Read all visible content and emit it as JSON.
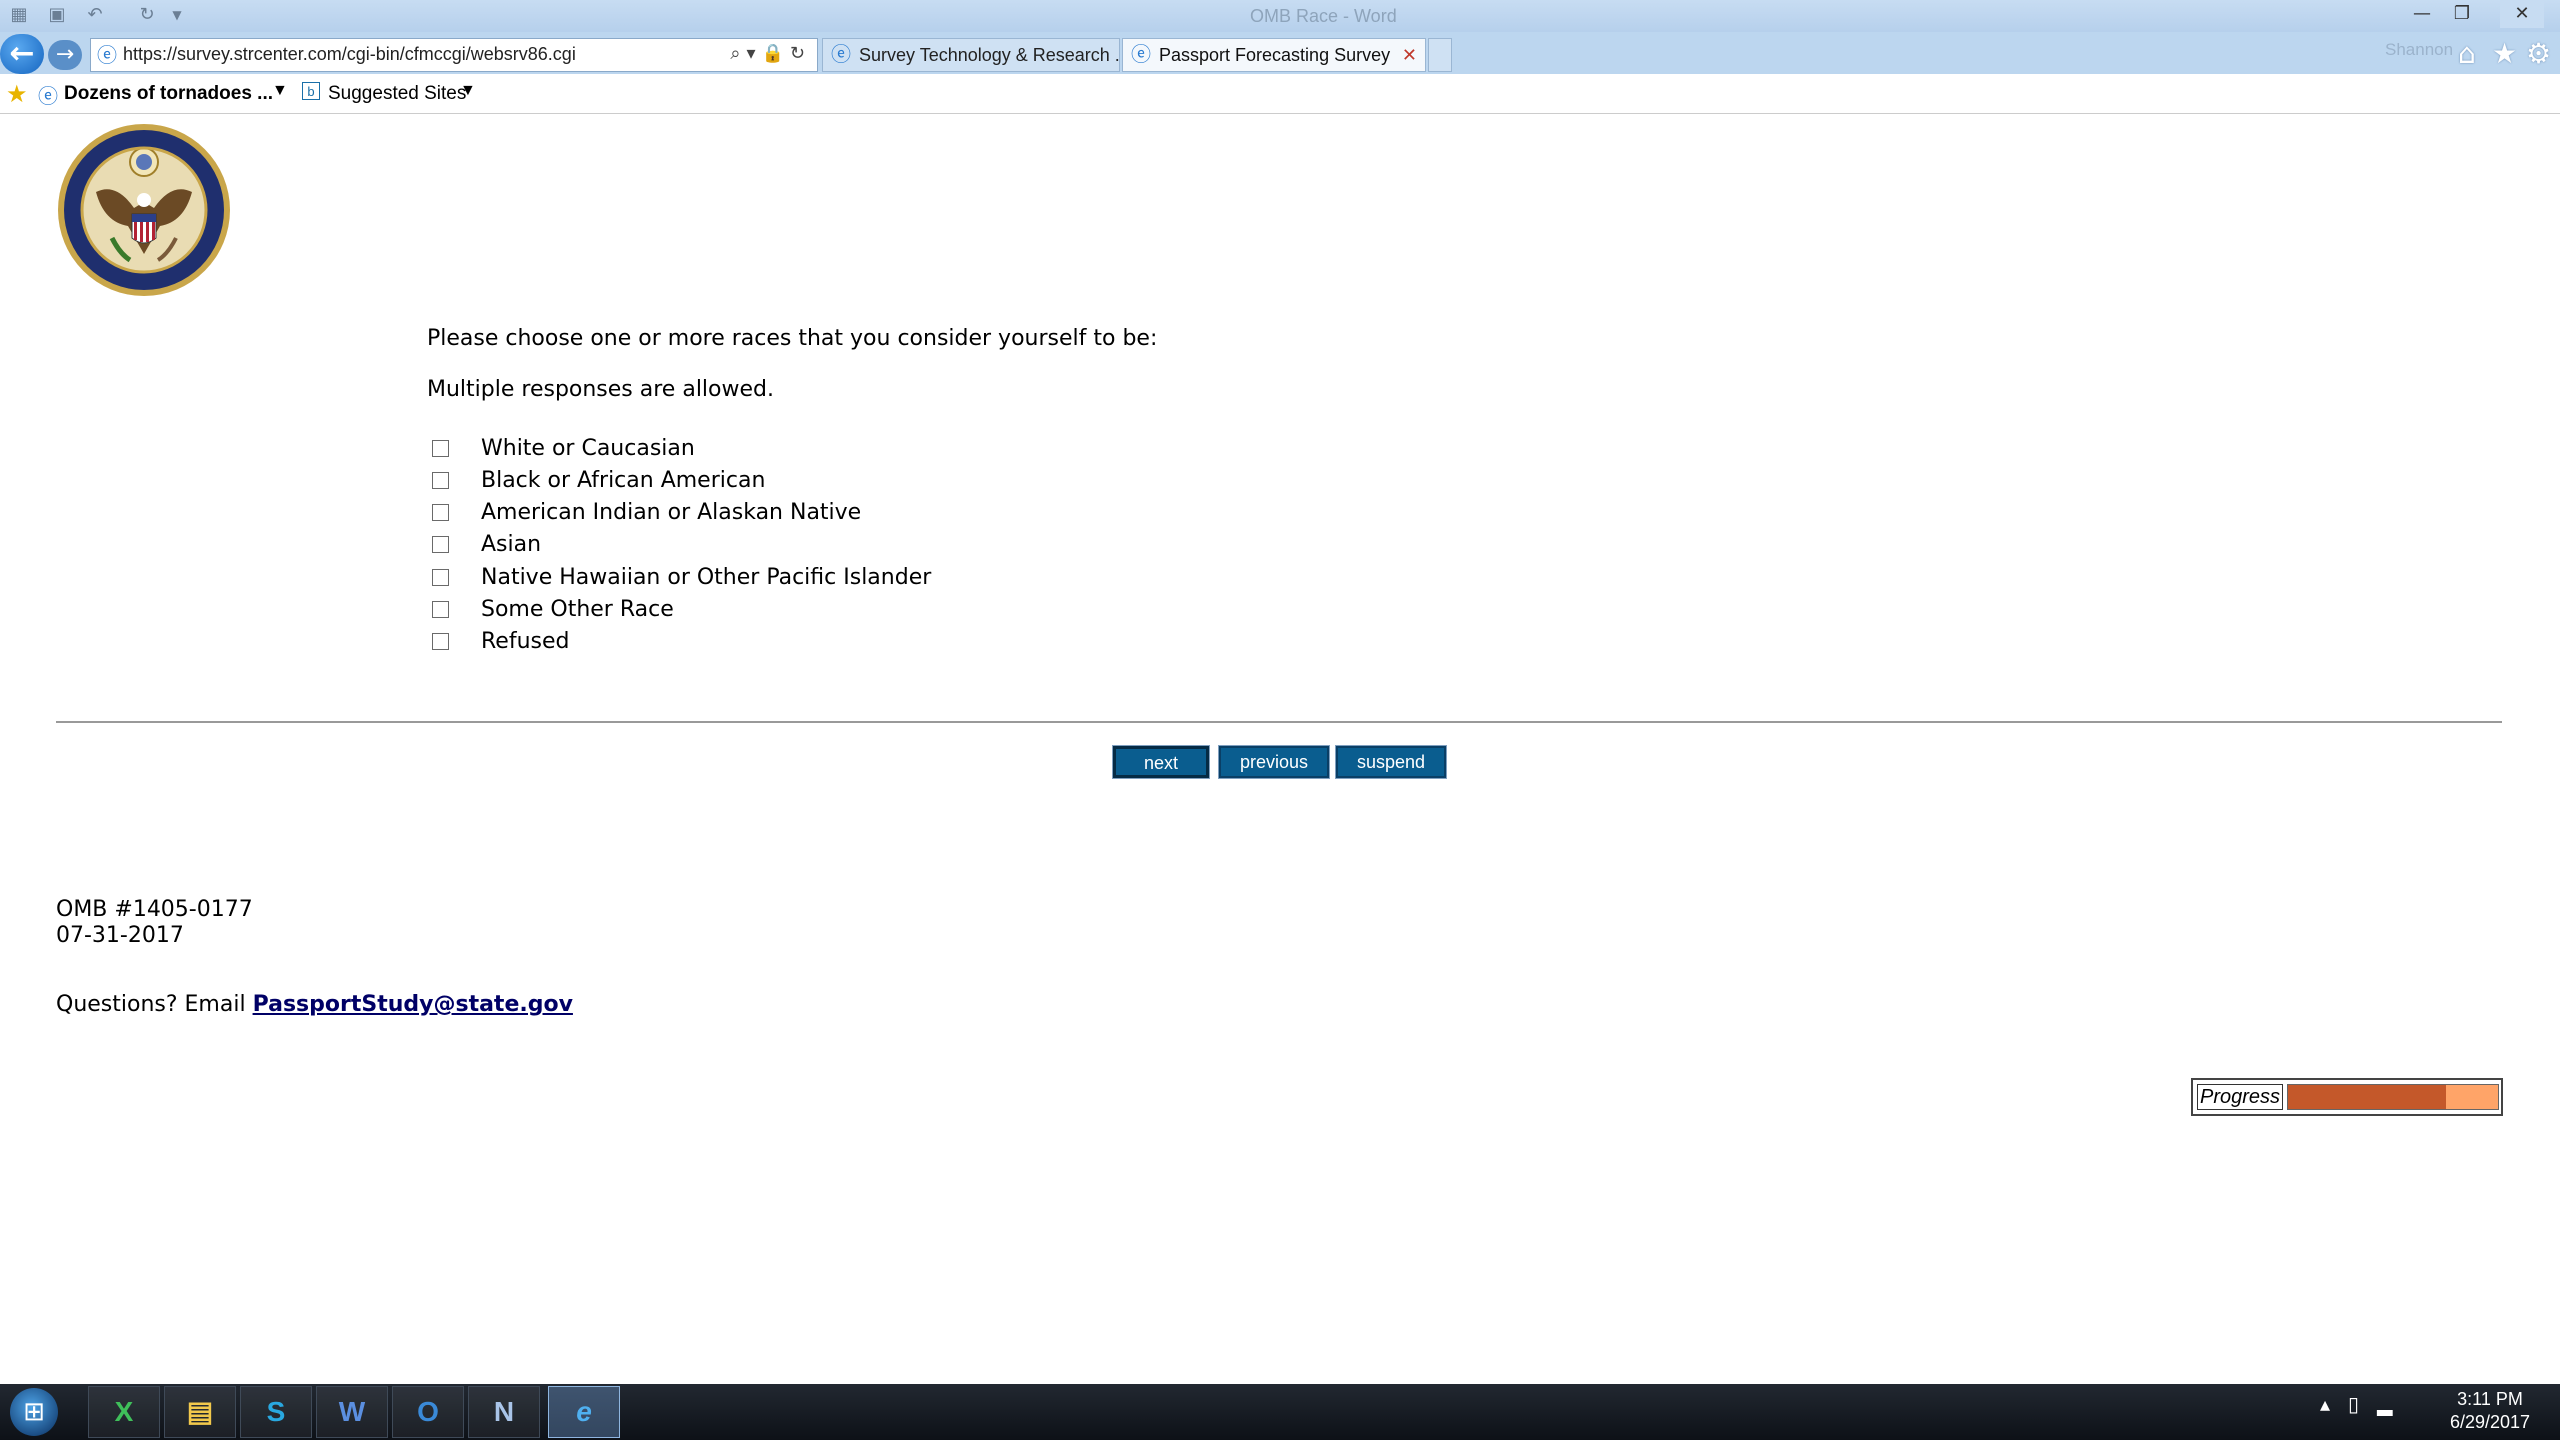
{
  "window": {
    "title": "OMB Race - Word",
    "minimize_glyph": "—",
    "restore_glyph": "❐",
    "close_glyph": "✕"
  },
  "browser": {
    "address": "https://survey.strcenter.com/cgi-bin/cfmccgi/websrv86.cgi",
    "tabs": [
      {
        "label": "Survey Technology & Research ..."
      },
      {
        "label": "Passport Forecasting Survey"
      }
    ],
    "user_name": "Shannon"
  },
  "favorites": {
    "items": [
      {
        "label": "Dozens of tornadoes ..."
      },
      {
        "label": "Suggested Sites"
      }
    ]
  },
  "survey": {
    "question": "Please choose one or more races that you consider yourself to be:",
    "instruction": "Multiple responses are allowed.",
    "options": [
      {
        "label": "White or Caucasian",
        "checked": false
      },
      {
        "label": "Black or African American",
        "checked": false
      },
      {
        "label": "American Indian or Alaskan Native",
        "checked": false
      },
      {
        "label": "Asian",
        "checked": false
      },
      {
        "label": "Native Hawaiian or Other Pacific Islander",
        "checked": false
      },
      {
        "label": "Some Other Race",
        "checked": false
      },
      {
        "label": "Refused",
        "checked": false
      }
    ],
    "buttons": {
      "next": "next",
      "previous": "previous",
      "suspend": "suspend"
    },
    "omb_number": "OMB #1405-0177",
    "omb_date": "07-31-2017",
    "questions_prefix": "Questions? Email ",
    "email": "PassportStudy@state.gov",
    "progress_label": "Progress",
    "progress_fraction": 0.75
  },
  "taskbar": {
    "apps": [
      {
        "name": "excel",
        "glyph": "X"
      },
      {
        "name": "file-explorer",
        "glyph": "▤"
      },
      {
        "name": "skype",
        "glyph": "S"
      },
      {
        "name": "word",
        "glyph": "W"
      },
      {
        "name": "outlook",
        "glyph": "O"
      },
      {
        "name": "n-app",
        "glyph": "N"
      },
      {
        "name": "internet-explorer",
        "glyph": "e"
      }
    ],
    "time": "3:11 PM",
    "date": "6/29/2017"
  },
  "colors": {
    "button_bg": "#0a5d8f",
    "progress_fill": "#c4582a",
    "progress_track": "#ffa468",
    "link": "#000066"
  }
}
